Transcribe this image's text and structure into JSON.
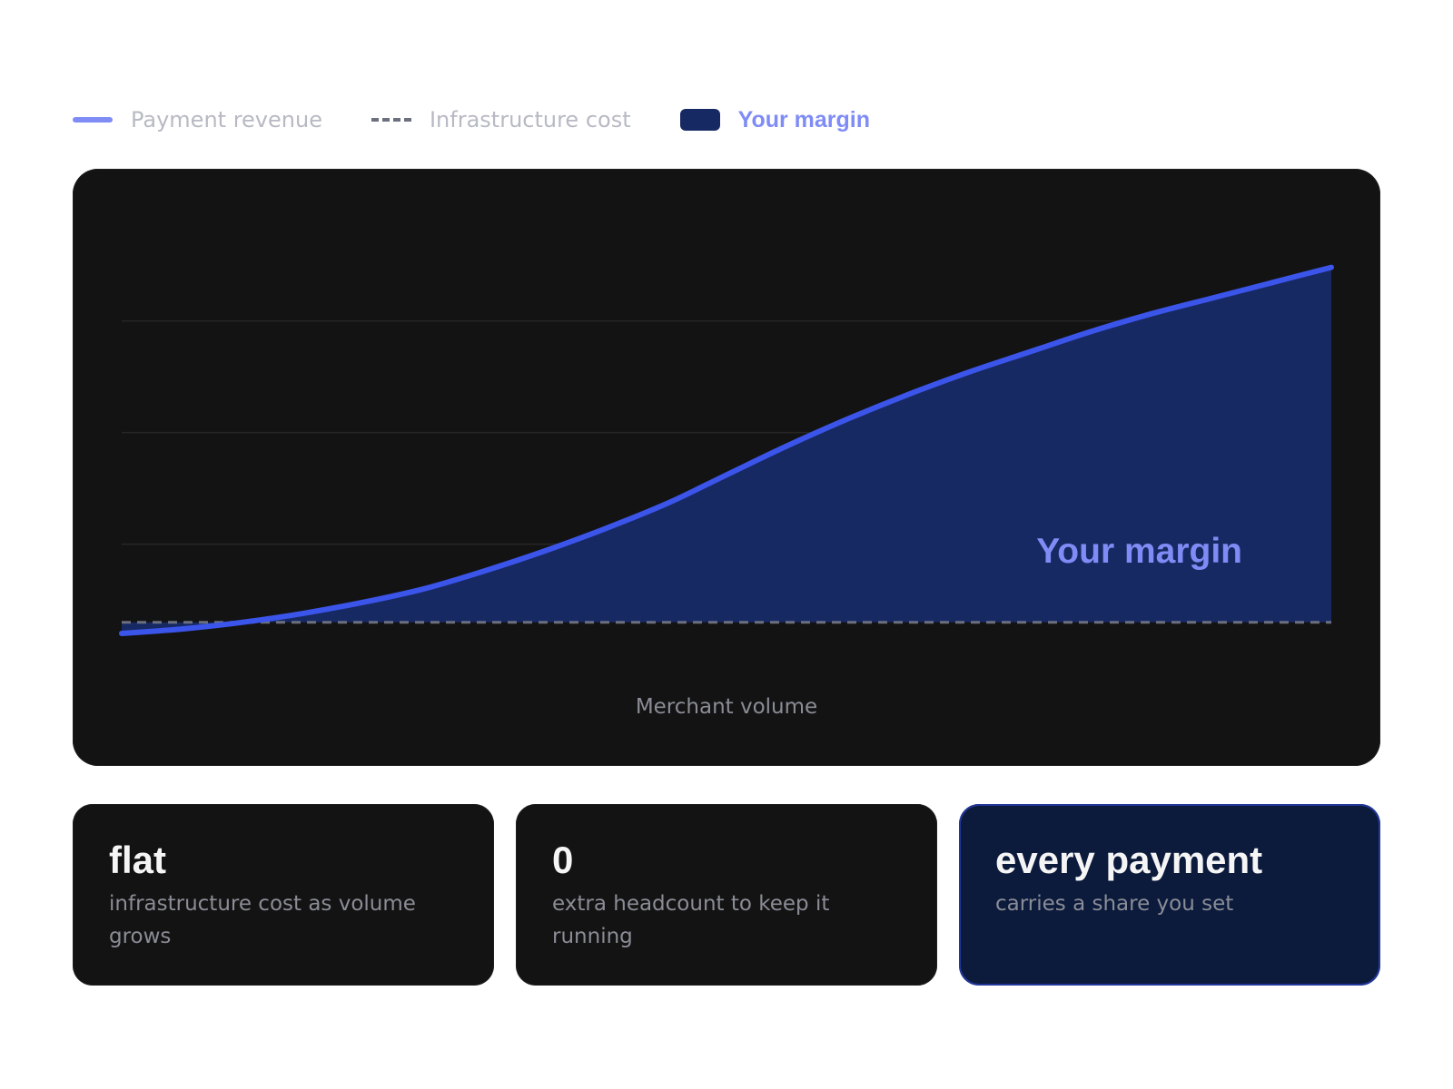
{
  "legend": {
    "revenue_label": "Payment revenue",
    "cost_label": "Infrastructure cost",
    "margin_label": "Your margin"
  },
  "colors": {
    "revenue": "#3b55ea",
    "revenue_legend": "#7f8cf5",
    "cost": "#6b6f7e",
    "margin_fill": "#172963",
    "margin_text": "#7f8cf5",
    "card_bg": "#131313",
    "highlight_bg": "#0c1a3c"
  },
  "chart_data": {
    "type": "area",
    "xlabel": "Merchant volume",
    "ylabel": "",
    "area_annotation": "Your margin",
    "grid": true,
    "ylim": [
      0,
      1
    ],
    "xlim": [
      0,
      1
    ],
    "series": [
      {
        "name": "Payment revenue",
        "x": [
          0,
          0.05,
          0.1,
          0.15,
          0.2,
          0.25,
          0.3,
          0.35,
          0.4,
          0.45,
          0.5,
          0.55,
          0.6,
          0.65,
          0.7,
          0.75,
          0.8,
          0.85,
          0.9,
          0.95,
          1.0
        ],
        "values": [
          0.0,
          0.01,
          0.025,
          0.045,
          0.07,
          0.1,
          0.14,
          0.185,
          0.235,
          0.29,
          0.355,
          0.42,
          0.48,
          0.535,
          0.585,
          0.63,
          0.675,
          0.715,
          0.75,
          0.785,
          0.82
        ]
      },
      {
        "name": "Infrastructure cost",
        "x": [
          0,
          1.0
        ],
        "values": [
          0.025,
          0.025
        ]
      }
    ]
  },
  "stats": [
    {
      "value": "flat",
      "desc": "infrastructure cost as volume grows"
    },
    {
      "value": "0",
      "desc": "extra headcount to keep it running"
    },
    {
      "value": "every payment",
      "desc": "carries a share you set"
    }
  ]
}
